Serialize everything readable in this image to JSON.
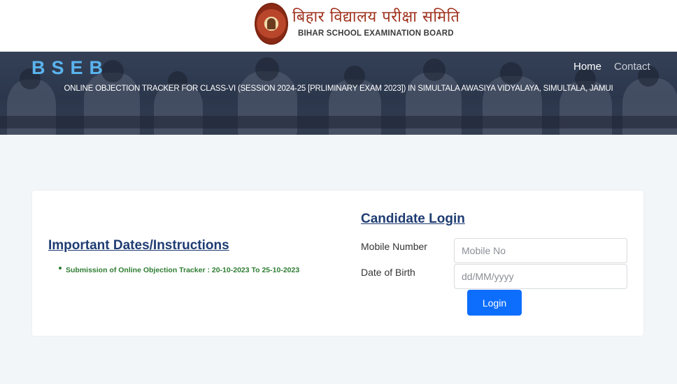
{
  "header": {
    "logo_icon": "bseb-seal-icon",
    "title_hindi": "बिहार विद्यालय परीक्षा समिति",
    "title_english": "BIHAR SCHOOL EXAMINATION BOARD"
  },
  "banner": {
    "brand": "BSEB",
    "nav": {
      "home": "Home",
      "contact": "Contact"
    },
    "title": "ONLINE OBJECTION TRACKER FOR CLASS-VI (SESSION 2024-25 [PRLIMINARY EXAM 2023]) IN SIMULTALA AWASIYA VIDYALAYA, SIMULTALA, JAMUI"
  },
  "dates": {
    "heading": "Important Dates/Instructions",
    "items": [
      "Submission of Online Objection Tracker : 20-10-2023 To 25-10-2023"
    ]
  },
  "login": {
    "heading": "Candidate Login",
    "mobile_label": "Mobile Number",
    "mobile_placeholder": "Mobile No",
    "dob_label": "Date of Birth",
    "dob_placeholder": "dd/MM/yyyy",
    "button": "Login"
  },
  "colors": {
    "brand": "#5ab4ef",
    "heading": "#1e3c72",
    "instruction": "#2e7d32",
    "button": "#0d6efd"
  }
}
